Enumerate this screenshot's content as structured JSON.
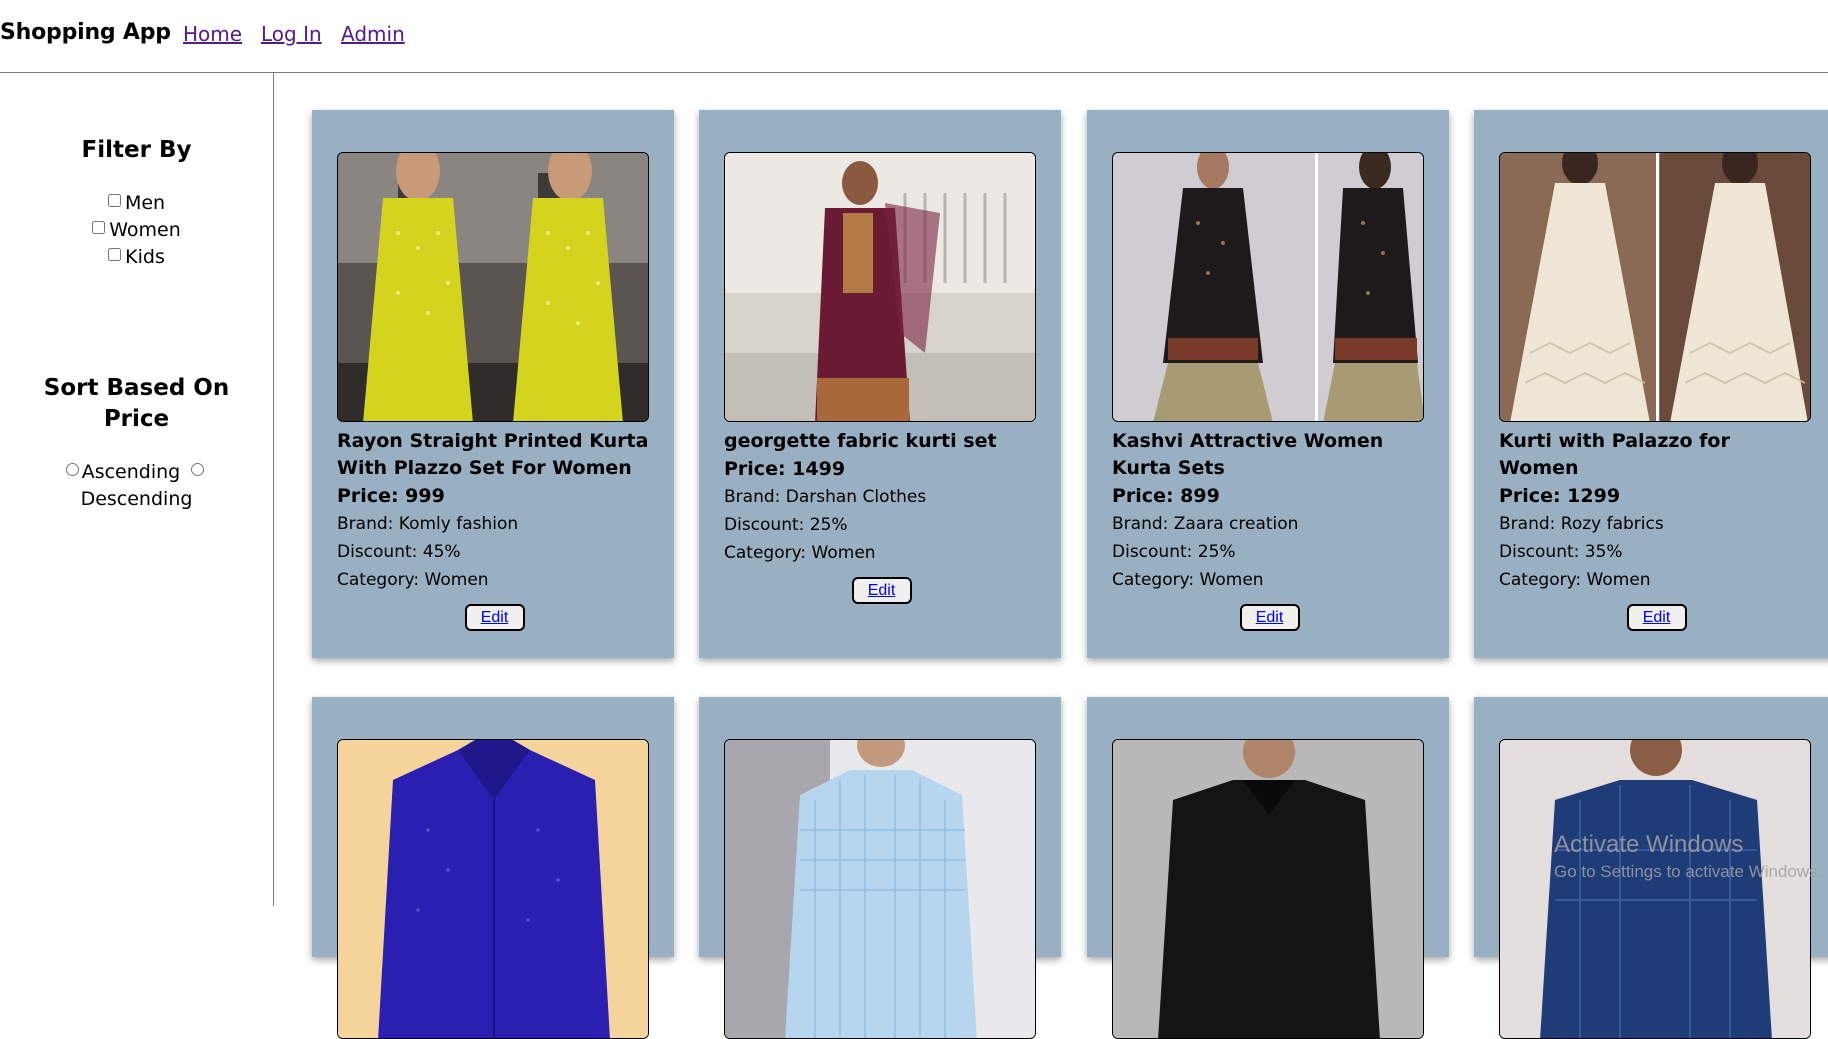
{
  "navbar": {
    "brand": "Shopping App",
    "links": [
      "Home",
      "Log In",
      "Admin"
    ]
  },
  "sidebar": {
    "filter_heading": "Filter By",
    "filters": [
      "Men",
      "Women",
      "Kids"
    ],
    "sort_heading": "Sort Based On Price",
    "sort_options": [
      "Ascending",
      "Descending"
    ]
  },
  "products": [
    {
      "title": "Rayon Straight Printed Kurta With Plazzo Set For Women",
      "price": "Price: 999",
      "brand": "Brand: Komly fashion",
      "discount": "Discount: 45%",
      "category": "Category: Women",
      "edit_label": "Edit",
      "image": "yellow-kurta-photo"
    },
    {
      "title": "georgette fabric kurti set",
      "price": "Price: 1499",
      "brand": "Brand: Darshan Clothes",
      "discount": "Discount: 25%",
      "category": "Category: Women",
      "edit_label": "Edit",
      "image": "maroon-kurti-photo"
    },
    {
      "title": "Kashvi Attractive Women Kurta Sets",
      "price": "Price: 899",
      "brand": "Brand: Zaara creation",
      "discount": "Discount: 25%",
      "category": "Category: Women",
      "edit_label": "Edit",
      "image": "black-kurta-photo"
    },
    {
      "title": "Kurti with Palazzo for Women",
      "price": "Price: 1299",
      "brand": "Brand: Rozy fabrics",
      "discount": "Discount: 35%",
      "category": "Category: Women",
      "edit_label": "Edit",
      "image": "white-kurti-photo"
    },
    {
      "image": "blue-polka-shirt-photo"
    },
    {
      "image": "light-blue-check-shirt-photo"
    },
    {
      "image": "black-shirt-photo"
    },
    {
      "image": "blue-check-shirt-photo"
    }
  ],
  "watermark": {
    "title": "Activate Windows",
    "subtitle": "Go to Settings to activate Windows."
  },
  "colors": {
    "card_background": "#99b0c2",
    "link_visited": "#551a8b",
    "link": "#0000ee"
  }
}
